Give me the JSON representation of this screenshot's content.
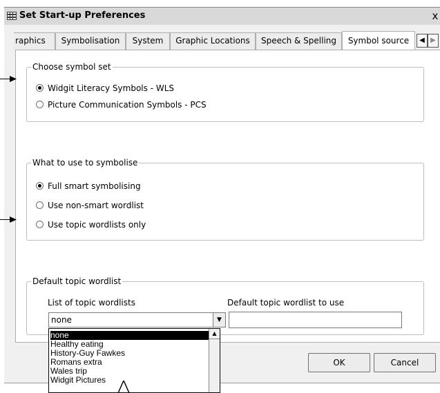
{
  "window": {
    "title": "Set Start-up Preferences",
    "close_glyph": "x",
    "icon": "grid-app-icon"
  },
  "tabs": [
    {
      "label": "raphics",
      "active": false
    },
    {
      "label": "Symbolisation",
      "active": false
    },
    {
      "label": "System",
      "active": false
    },
    {
      "label": "Graphic Locations",
      "active": false
    },
    {
      "label": "Speech & Spelling",
      "active": false
    },
    {
      "label": "Symbol source",
      "active": true
    }
  ],
  "tab_scroll": {
    "left_glyph": "◀",
    "right_glyph": "▶"
  },
  "symbol_set": {
    "legend": "Choose symbol set",
    "options": [
      {
        "label": "Widgit Literacy Symbols - WLS",
        "selected": true
      },
      {
        "label": "Picture Communication Symbols - PCS",
        "selected": false
      }
    ]
  },
  "symbolise": {
    "legend": "What to use to symbolise",
    "options": [
      {
        "label": "Full smart symbolising",
        "selected": true
      },
      {
        "label": "Use non-smart wordlist",
        "selected": false
      },
      {
        "label": "Use topic wordlists only",
        "selected": false
      }
    ]
  },
  "topic": {
    "legend": "Default topic wordlist",
    "list_label": "List of topic wordlists",
    "default_label": "Default topic wordlist to use",
    "combo_value": "none",
    "default_value": "",
    "dropdown_items": [
      "none",
      "Healthy eating",
      "History-Guy Fawkes",
      "Romans extra",
      "Wales trip",
      "Widgit Pictures"
    ],
    "selected_index": 0
  },
  "buttons": {
    "ok": "OK",
    "cancel": "Cancel"
  }
}
